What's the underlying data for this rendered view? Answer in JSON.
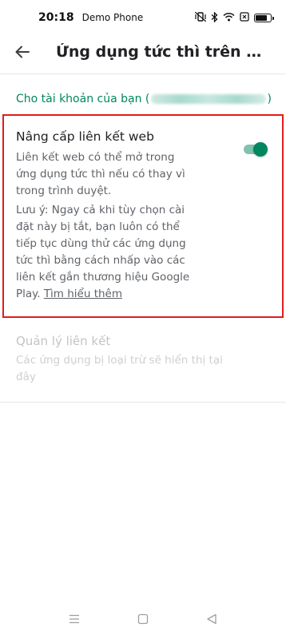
{
  "status_bar": {
    "time": "20:18",
    "device_name": "Demo Phone"
  },
  "app_bar": {
    "title": "Ứng dụng tức thì trên Google..."
  },
  "account": {
    "prefix": "Cho tài khoản của bạn (",
    "suffix": ")"
  },
  "upgrade_links": {
    "title": "Nâng cấp liên kết web",
    "description": "Liên kết web có thể mở trong ứng dụng tức thì nếu có thay vì trong trình duyệt.",
    "note": "Lưu ý: Ngay cả khi tùy chọn cài đặt này bị tắt, bạn luôn có thể tiếp tục dùng thử các ứng dụng tức thì bằng cách nhấp vào các liên kết gắn thương hiệu Google Play.",
    "learn_more": "Tìm hiểu thêm",
    "toggle_on": true
  },
  "manage_links": {
    "title": "Quản lý liên kết",
    "description": "Các ứng dụng bị loại trừ sẽ hiển thị tại đây"
  },
  "colors": {
    "accent": "#01875f",
    "highlight_border": "#e21b1b"
  }
}
